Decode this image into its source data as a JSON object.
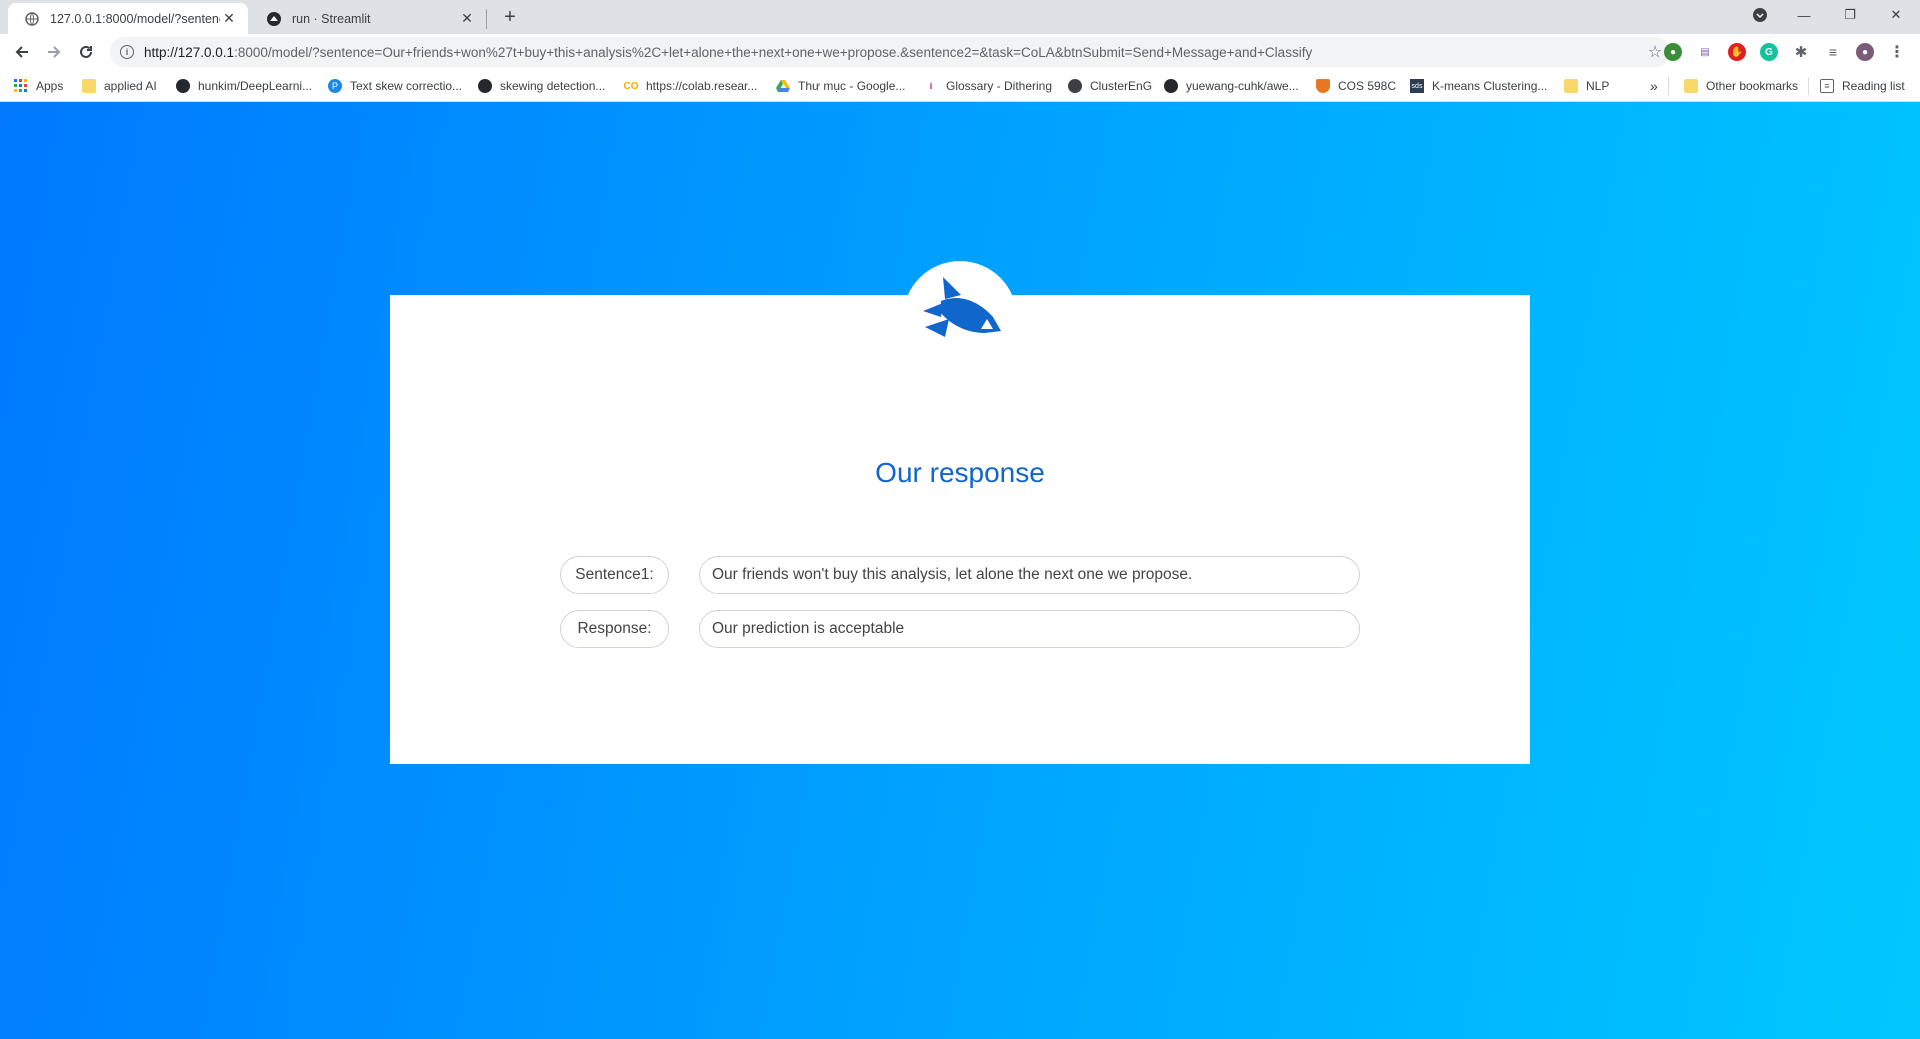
{
  "tabs": [
    {
      "title": "127.0.0.1:8000/model/?sentence",
      "close": "✕"
    },
    {
      "title": "run · Streamlit",
      "close": "✕"
    }
  ],
  "new_tab": "+",
  "window": {
    "minimize": "—",
    "restore": "❐",
    "close": "✕"
  },
  "address_bar": {
    "url_host": "http://127.0.0.1",
    "url_rest": ":8000/model/?sentence=Our+friends+won%27t+buy+this+analysis%2C+let+alone+the+next+one+we+propose.&sentence2=&task=CoLA&btnSubmit=Send+Message+and+Classify"
  },
  "bookmarks": [
    {
      "label": "Apps",
      "icon": "apps-grid-icon"
    },
    {
      "label": "applied AI",
      "icon": "folder-icon"
    },
    {
      "label": "hunkim/DeepLearni...",
      "icon": "github-icon"
    },
    {
      "label": "Text skew correctio...",
      "icon": "site-icon"
    },
    {
      "label": "skewing detection...",
      "icon": "github-icon"
    },
    {
      "label": "https://colab.resear...",
      "icon": "colab-icon"
    },
    {
      "label": "Thư mục - Google...",
      "icon": "drive-icon"
    },
    {
      "label": "Glossary - Dithering",
      "icon": "site-icon"
    },
    {
      "label": "ClusterEnG",
      "icon": "globe-icon"
    },
    {
      "label": "yuewang-cuhk/awe...",
      "icon": "github-icon"
    },
    {
      "label": "COS 598C",
      "icon": "princeton-icon"
    },
    {
      "label": "K-means Clustering...",
      "icon": "site-icon"
    },
    {
      "label": "NLP",
      "icon": "folder-icon"
    }
  ],
  "bookmarks_overflow": "»",
  "other_bookmarks": "Other bookmarks",
  "reading_list": "Reading list",
  "main": {
    "heading": "Our response",
    "rows": [
      {
        "label": "Sentence1:",
        "value": "Our friends won't buy this analysis, let alone the next one we propose."
      },
      {
        "label": "Response:",
        "value": "Our prediction is acceptable"
      }
    ]
  },
  "colors": {
    "accent": "#1166cc",
    "gradient_start": "#0079ff",
    "gradient_end": "#00c8ff"
  }
}
